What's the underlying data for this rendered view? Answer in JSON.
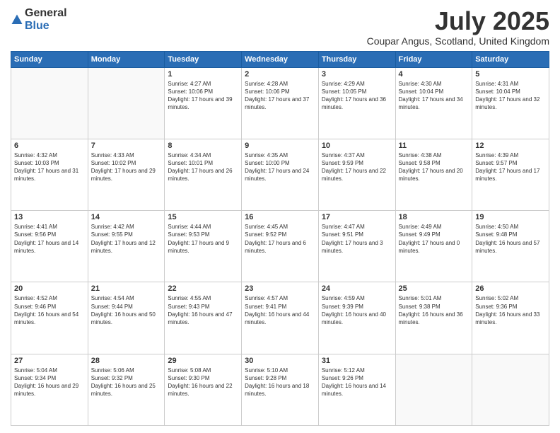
{
  "logo": {
    "general": "General",
    "blue": "Blue"
  },
  "header": {
    "month": "July 2025",
    "location": "Coupar Angus, Scotland, United Kingdom"
  },
  "days_of_week": [
    "Sunday",
    "Monday",
    "Tuesday",
    "Wednesday",
    "Thursday",
    "Friday",
    "Saturday"
  ],
  "weeks": [
    [
      {
        "day": "",
        "sunrise": "",
        "sunset": "",
        "daylight": ""
      },
      {
        "day": "",
        "sunrise": "",
        "sunset": "",
        "daylight": ""
      },
      {
        "day": "1",
        "sunrise": "Sunrise: 4:27 AM",
        "sunset": "Sunset: 10:06 PM",
        "daylight": "Daylight: 17 hours and 39 minutes."
      },
      {
        "day": "2",
        "sunrise": "Sunrise: 4:28 AM",
        "sunset": "Sunset: 10:06 PM",
        "daylight": "Daylight: 17 hours and 37 minutes."
      },
      {
        "day": "3",
        "sunrise": "Sunrise: 4:29 AM",
        "sunset": "Sunset: 10:05 PM",
        "daylight": "Daylight: 17 hours and 36 minutes."
      },
      {
        "day": "4",
        "sunrise": "Sunrise: 4:30 AM",
        "sunset": "Sunset: 10:04 PM",
        "daylight": "Daylight: 17 hours and 34 minutes."
      },
      {
        "day": "5",
        "sunrise": "Sunrise: 4:31 AM",
        "sunset": "Sunset: 10:04 PM",
        "daylight": "Daylight: 17 hours and 32 minutes."
      }
    ],
    [
      {
        "day": "6",
        "sunrise": "Sunrise: 4:32 AM",
        "sunset": "Sunset: 10:03 PM",
        "daylight": "Daylight: 17 hours and 31 minutes."
      },
      {
        "day": "7",
        "sunrise": "Sunrise: 4:33 AM",
        "sunset": "Sunset: 10:02 PM",
        "daylight": "Daylight: 17 hours and 29 minutes."
      },
      {
        "day": "8",
        "sunrise": "Sunrise: 4:34 AM",
        "sunset": "Sunset: 10:01 PM",
        "daylight": "Daylight: 17 hours and 26 minutes."
      },
      {
        "day": "9",
        "sunrise": "Sunrise: 4:35 AM",
        "sunset": "Sunset: 10:00 PM",
        "daylight": "Daylight: 17 hours and 24 minutes."
      },
      {
        "day": "10",
        "sunrise": "Sunrise: 4:37 AM",
        "sunset": "Sunset: 9:59 PM",
        "daylight": "Daylight: 17 hours and 22 minutes."
      },
      {
        "day": "11",
        "sunrise": "Sunrise: 4:38 AM",
        "sunset": "Sunset: 9:58 PM",
        "daylight": "Daylight: 17 hours and 20 minutes."
      },
      {
        "day": "12",
        "sunrise": "Sunrise: 4:39 AM",
        "sunset": "Sunset: 9:57 PM",
        "daylight": "Daylight: 17 hours and 17 minutes."
      }
    ],
    [
      {
        "day": "13",
        "sunrise": "Sunrise: 4:41 AM",
        "sunset": "Sunset: 9:56 PM",
        "daylight": "Daylight: 17 hours and 14 minutes."
      },
      {
        "day": "14",
        "sunrise": "Sunrise: 4:42 AM",
        "sunset": "Sunset: 9:55 PM",
        "daylight": "Daylight: 17 hours and 12 minutes."
      },
      {
        "day": "15",
        "sunrise": "Sunrise: 4:44 AM",
        "sunset": "Sunset: 9:53 PM",
        "daylight": "Daylight: 17 hours and 9 minutes."
      },
      {
        "day": "16",
        "sunrise": "Sunrise: 4:45 AM",
        "sunset": "Sunset: 9:52 PM",
        "daylight": "Daylight: 17 hours and 6 minutes."
      },
      {
        "day": "17",
        "sunrise": "Sunrise: 4:47 AM",
        "sunset": "Sunset: 9:51 PM",
        "daylight": "Daylight: 17 hours and 3 minutes."
      },
      {
        "day": "18",
        "sunrise": "Sunrise: 4:49 AM",
        "sunset": "Sunset: 9:49 PM",
        "daylight": "Daylight: 17 hours and 0 minutes."
      },
      {
        "day": "19",
        "sunrise": "Sunrise: 4:50 AM",
        "sunset": "Sunset: 9:48 PM",
        "daylight": "Daylight: 16 hours and 57 minutes."
      }
    ],
    [
      {
        "day": "20",
        "sunrise": "Sunrise: 4:52 AM",
        "sunset": "Sunset: 9:46 PM",
        "daylight": "Daylight: 16 hours and 54 minutes."
      },
      {
        "day": "21",
        "sunrise": "Sunrise: 4:54 AM",
        "sunset": "Sunset: 9:44 PM",
        "daylight": "Daylight: 16 hours and 50 minutes."
      },
      {
        "day": "22",
        "sunrise": "Sunrise: 4:55 AM",
        "sunset": "Sunset: 9:43 PM",
        "daylight": "Daylight: 16 hours and 47 minutes."
      },
      {
        "day": "23",
        "sunrise": "Sunrise: 4:57 AM",
        "sunset": "Sunset: 9:41 PM",
        "daylight": "Daylight: 16 hours and 44 minutes."
      },
      {
        "day": "24",
        "sunrise": "Sunrise: 4:59 AM",
        "sunset": "Sunset: 9:39 PM",
        "daylight": "Daylight: 16 hours and 40 minutes."
      },
      {
        "day": "25",
        "sunrise": "Sunrise: 5:01 AM",
        "sunset": "Sunset: 9:38 PM",
        "daylight": "Daylight: 16 hours and 36 minutes."
      },
      {
        "day": "26",
        "sunrise": "Sunrise: 5:02 AM",
        "sunset": "Sunset: 9:36 PM",
        "daylight": "Daylight: 16 hours and 33 minutes."
      }
    ],
    [
      {
        "day": "27",
        "sunrise": "Sunrise: 5:04 AM",
        "sunset": "Sunset: 9:34 PM",
        "daylight": "Daylight: 16 hours and 29 minutes."
      },
      {
        "day": "28",
        "sunrise": "Sunrise: 5:06 AM",
        "sunset": "Sunset: 9:32 PM",
        "daylight": "Daylight: 16 hours and 25 minutes."
      },
      {
        "day": "29",
        "sunrise": "Sunrise: 5:08 AM",
        "sunset": "Sunset: 9:30 PM",
        "daylight": "Daylight: 16 hours and 22 minutes."
      },
      {
        "day": "30",
        "sunrise": "Sunrise: 5:10 AM",
        "sunset": "Sunset: 9:28 PM",
        "daylight": "Daylight: 16 hours and 18 minutes."
      },
      {
        "day": "31",
        "sunrise": "Sunrise: 5:12 AM",
        "sunset": "Sunset: 9:26 PM",
        "daylight": "Daylight: 16 hours and 14 minutes."
      },
      {
        "day": "",
        "sunrise": "",
        "sunset": "",
        "daylight": ""
      },
      {
        "day": "",
        "sunrise": "",
        "sunset": "",
        "daylight": ""
      }
    ]
  ]
}
